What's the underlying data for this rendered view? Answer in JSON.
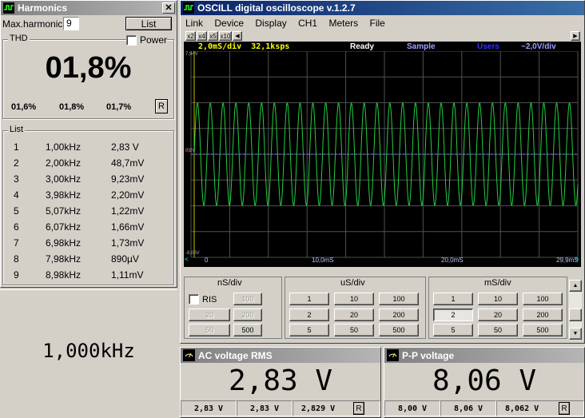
{
  "harmonics": {
    "title": "Harmonics",
    "max_harmonic_label": "Max.harmonic",
    "max_harmonic_value": "9",
    "list_button": "List",
    "thd_label": "THD",
    "power_label": "Power",
    "thd_value": "01,8%",
    "sub_values": [
      "01,6%",
      "01,8%",
      "01,7%"
    ],
    "reset_label": "R",
    "list_label": "List",
    "rows": [
      {
        "n": "1",
        "freq": "1,00kHz",
        "val": "2,83 V"
      },
      {
        "n": "2",
        "freq": "2,00kHz",
        "val": "48,7mV"
      },
      {
        "n": "3",
        "freq": "3,00kHz",
        "val": "9,23mV"
      },
      {
        "n": "4",
        "freq": "3,98kHz",
        "val": "2,20mV"
      },
      {
        "n": "5",
        "freq": "5,07kHz",
        "val": "1,22mV"
      },
      {
        "n": "6",
        "freq": "6,07kHz",
        "val": "1,66mV"
      },
      {
        "n": "7",
        "freq": "6,98kHz",
        "val": "1,73mV"
      },
      {
        "n": "8",
        "freq": "7,98kHz",
        "val": "890µV"
      },
      {
        "n": "9",
        "freq": "8,98kHz",
        "val": "1,11mV"
      }
    ]
  },
  "frequency_display": "1,000kHz",
  "osc": {
    "title": "OSCILL digital oscilloscope  v.1.2.7",
    "menu": [
      "Link",
      "Device",
      "Display",
      "CH1",
      "Meters",
      "File"
    ],
    "zoom_buttons": [
      "x2",
      "x4",
      "x5",
      "x10"
    ],
    "status": {
      "timebase": "2,0mS/div",
      "rate": "32,1ksps",
      "state": "Ready",
      "mode": "Sample",
      "trigger": "Users",
      "volts": "~2,0V/div"
    },
    "y_top": "7,94V",
    "y_mid": "0,2V",
    "y_bot": "-8,06V",
    "x_labels": [
      "0",
      "10,0mS",
      "20,0mS",
      "29,9mS"
    ],
    "colors": {
      "trace": "#20d040",
      "grid": "#505050",
      "screen": "#000000",
      "status_yellow": "#ffff00",
      "status_blue": "#6060ff"
    }
  },
  "timebase": {
    "ns_label": "nS/div",
    "us_label": "uS/div",
    "ms_label": "mS/div",
    "ris_label": "RIS",
    "ns_buttons": [
      "100",
      "20",
      "200",
      "50",
      "500"
    ],
    "us_buttons": [
      "1",
      "10",
      "100",
      "2",
      "20",
      "200",
      "5",
      "50",
      "500"
    ],
    "ms_buttons": [
      "1",
      "10",
      "100",
      "2",
      "20",
      "200",
      "5",
      "50",
      "500"
    ],
    "ms_selected": "2"
  },
  "meters": [
    {
      "title": "AC voltage RMS",
      "value": "2,83 V",
      "subs": [
        "2,83 V",
        "2,83 V",
        "2,829 V"
      ],
      "reset": "R"
    },
    {
      "title": "P-P voltage",
      "value": "8,06 V",
      "subs": [
        "8,00 V",
        "8,06 V",
        "8,062 V"
      ],
      "reset": "R"
    }
  ],
  "chart_data": {
    "type": "line",
    "series": [
      {
        "x_ms": [
          0,
          29.9
        ],
        "amplitude_vpp": 8.06,
        "frequency_khz": 1.0,
        "waveform": "sine"
      }
    ]
  }
}
